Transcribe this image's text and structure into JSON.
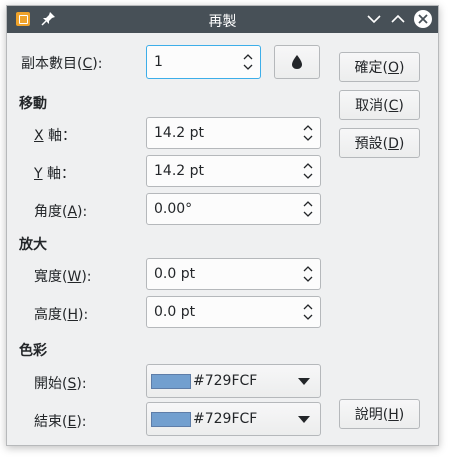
{
  "window": {
    "title": "再製"
  },
  "copies": {
    "label_pre": "副本數目(",
    "label_key": "C",
    "label_post": "):",
    "value": "1"
  },
  "move": {
    "heading": "移動",
    "x": {
      "label_key": "X",
      "label_post": " 軸：",
      "value": "14.2 pt"
    },
    "y": {
      "label_key": "Y",
      "label_post": " 軸：",
      "value": "14.2 pt"
    },
    "angle": {
      "label_pre": "角度(",
      "label_key": "A",
      "label_post": "):",
      "value": "0.00°"
    }
  },
  "enlarge": {
    "heading": "放大",
    "width": {
      "label_pre": "寬度(",
      "label_key": "W",
      "label_post": "):",
      "value": "0.0 pt"
    },
    "height": {
      "label_pre": "高度(",
      "label_key": "H",
      "label_post": "):",
      "value": "0.0 pt"
    }
  },
  "colors": {
    "heading": "色彩",
    "start": {
      "label_pre": "開始(",
      "label_key": "S",
      "label_post": "):",
      "value": "#729FCF",
      "swatch": "#729FCF"
    },
    "end": {
      "label_pre": "結束(",
      "label_key": "E",
      "label_post": "):",
      "value": "#729FCF",
      "swatch": "#729FCF"
    }
  },
  "buttons": {
    "ok": {
      "pre": "確定(",
      "key": "O",
      "post": ")"
    },
    "cancel": {
      "pre": "取消(",
      "key": "C",
      "post": ")"
    },
    "defaults": {
      "pre": "預設(",
      "key": "D",
      "post": ")"
    },
    "help": {
      "pre": "說明(",
      "key": "H",
      "post": ")"
    }
  },
  "icons": {
    "app": "app-icon",
    "pin": "pin-icon",
    "minimize": "chevron-down-icon",
    "maximize": "chevron-up-icon",
    "close": "close-icon",
    "values_from_selection": "droplet-icon"
  },
  "theme": {
    "titlebar": "#475057",
    "accent": "#3daee9",
    "window_bg": "#eff0f1"
  }
}
